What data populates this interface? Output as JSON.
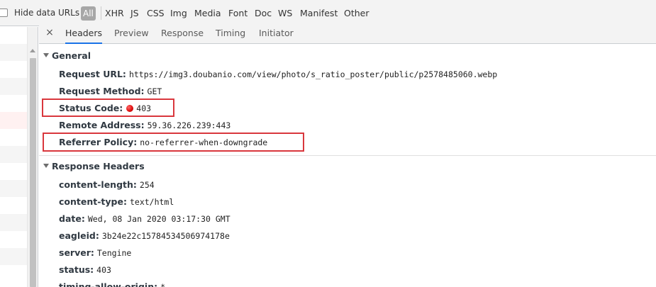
{
  "filter_bar": {
    "hide_data_urls_label": "Hide data URLs",
    "hide_data_urls_checked": false,
    "types": [
      "All",
      "XHR",
      "JS",
      "CSS",
      "Img",
      "Media",
      "Font",
      "Doc",
      "WS",
      "Manifest",
      "Other"
    ],
    "selected_type": "All"
  },
  "tabs": {
    "close_glyph": "×",
    "items": [
      "Headers",
      "Preview",
      "Response",
      "Timing",
      "Initiator"
    ],
    "active": "Headers"
  },
  "general": {
    "title": "General",
    "request_url": {
      "key": "Request URL:",
      "value": "https://img3.doubanio.com/view/photo/s_ratio_poster/public/p2578485060.webp"
    },
    "request_method": {
      "key": "Request Method:",
      "value": "GET"
    },
    "status_code": {
      "key": "Status Code:",
      "value": "403",
      "status_color": "#e01010"
    },
    "remote_address": {
      "key": "Remote Address:",
      "value": "59.36.226.239:443"
    },
    "referrer_policy": {
      "key": "Referrer Policy:",
      "value": "no-referrer-when-downgrade"
    }
  },
  "response_headers": {
    "title": "Response Headers",
    "items": [
      {
        "key": "content-length:",
        "value": "254"
      },
      {
        "key": "content-type:",
        "value": "text/html"
      },
      {
        "key": "date:",
        "value": "Wed, 08 Jan 2020 03:17:30 GMT"
      },
      {
        "key": "eagleid:",
        "value": "3b24e22c15784534506974178e"
      },
      {
        "key": "server:",
        "value": "Tengine"
      },
      {
        "key": "status:",
        "value": "403"
      },
      {
        "key": "timing-allow-origin:",
        "value": "*"
      }
    ]
  },
  "colors": {
    "highlight": "#d9373d",
    "active_tab": "#1a73e8",
    "error_row": "#fff1f1"
  }
}
